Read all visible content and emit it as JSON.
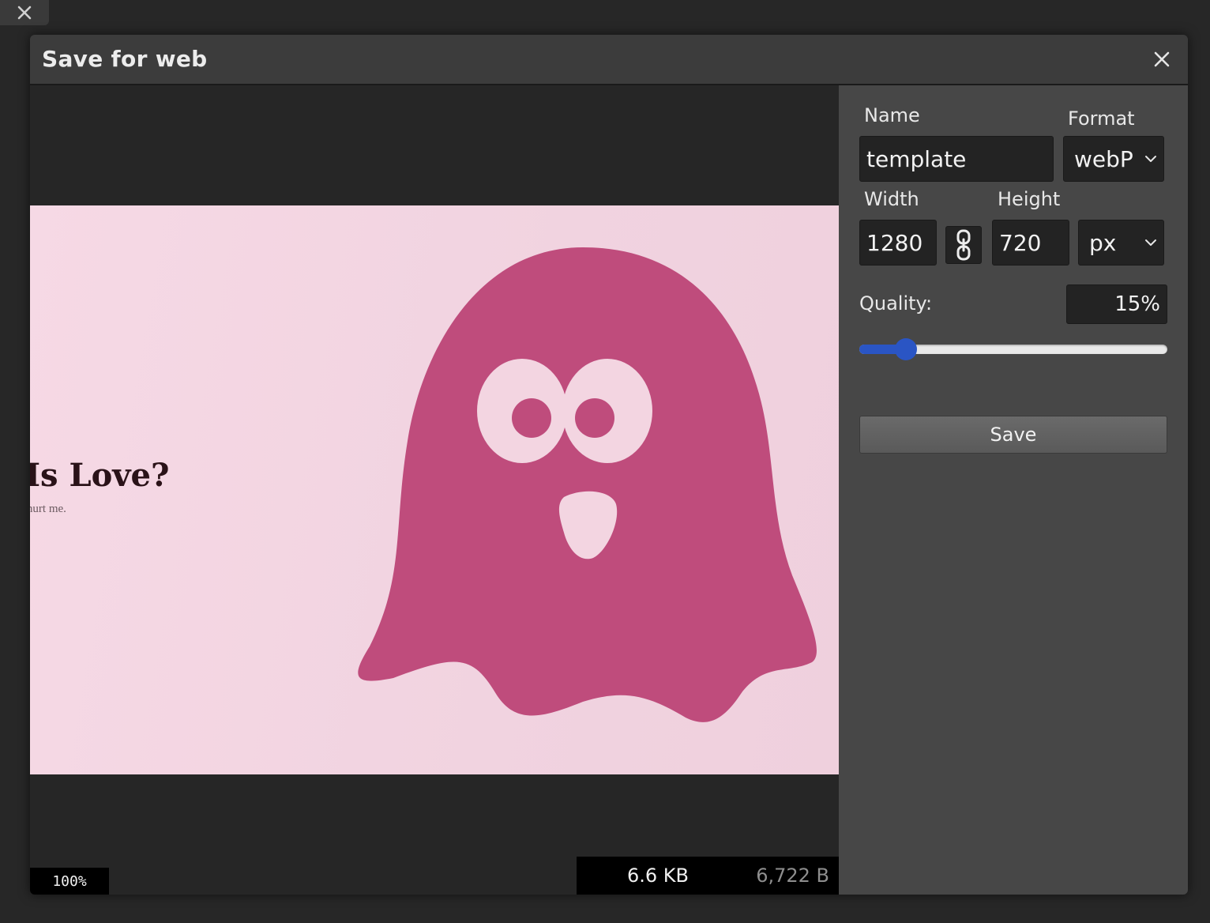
{
  "dialog": {
    "title": "Save for web"
  },
  "preview": {
    "image_title": "at Is Love?",
    "image_subtitle": "t hurt me.",
    "zoom": "100%",
    "size_kb": "6.6 KB",
    "size_bytes": "6,722 B"
  },
  "form": {
    "name_label": "Name",
    "name_value": "template",
    "format_label": "Format",
    "format_value": "webP",
    "width_label": "Width",
    "width_value": "1280",
    "height_label": "Height",
    "height_value": "720",
    "unit_value": "px",
    "quality_label": "Quality:",
    "quality_value": "15%",
    "quality_level": 0.15,
    "save_label": "Save"
  },
  "icons": {
    "background_close": "close-icon",
    "dialog_close": "close-icon",
    "aspect_lock": "link-icon",
    "format_dropdown": "chevron-down-icon",
    "unit_dropdown": "chevron-down-icon"
  },
  "colors": {
    "slider_accent": "#2a55c4",
    "ghost": "#bf4c7c",
    "canvas_background": "#f3d5e1"
  }
}
